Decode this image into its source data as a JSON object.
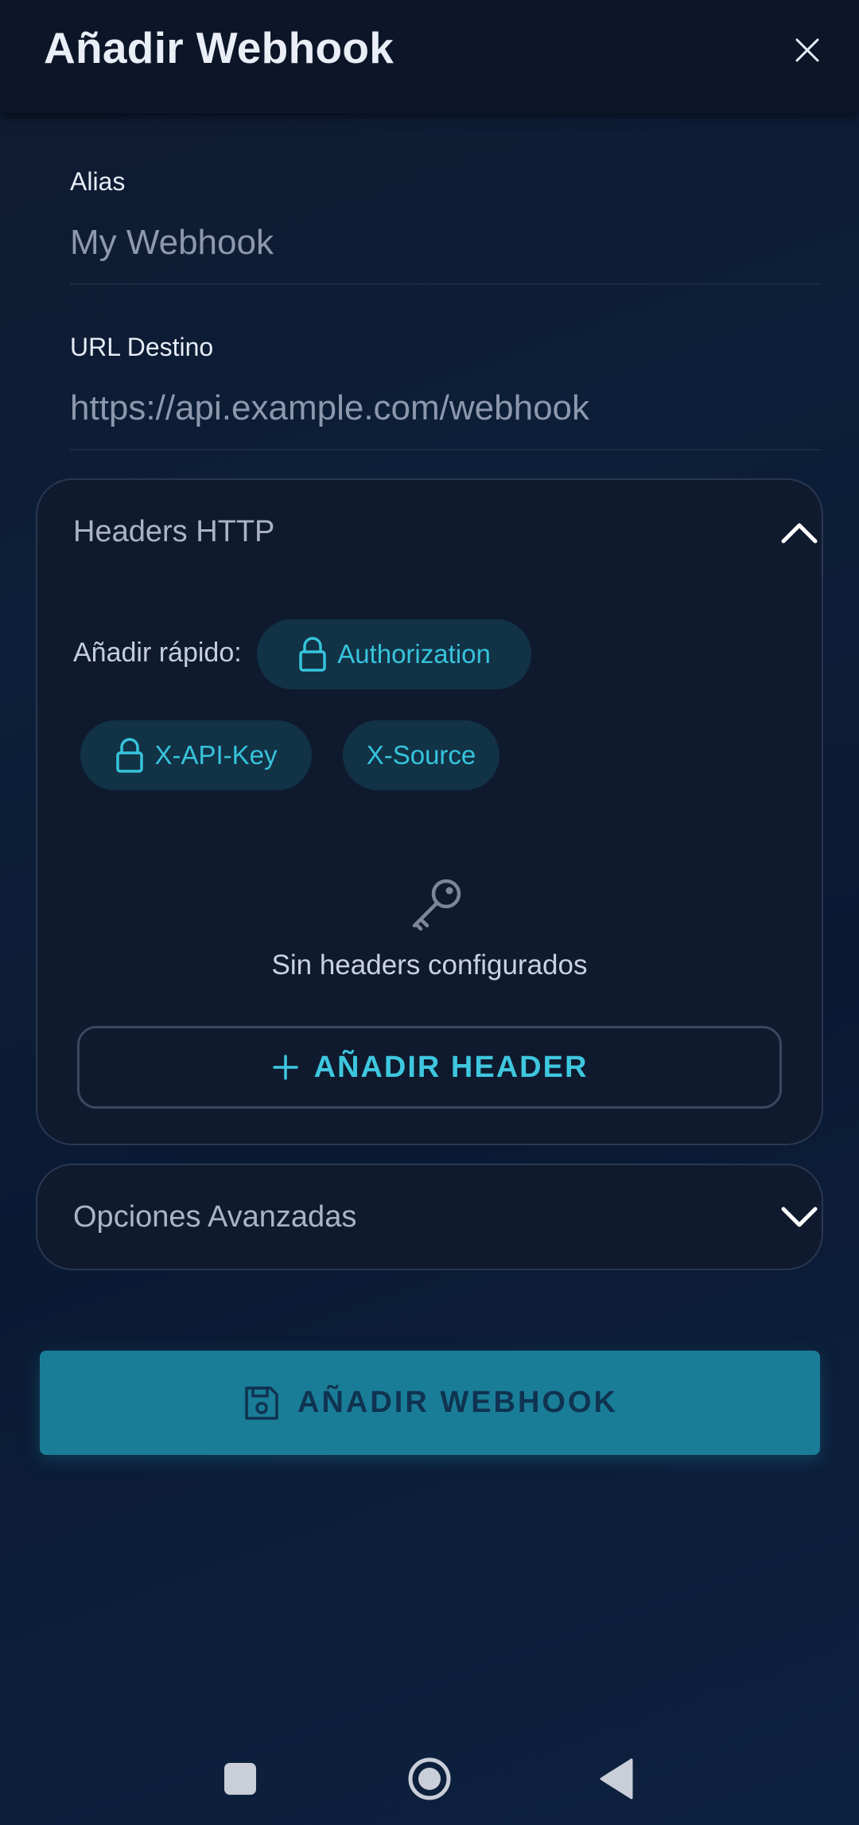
{
  "appbar": {
    "title": "Añadir Webhook",
    "close_icon": "close-icon"
  },
  "form": {
    "alias": {
      "label": "Alias",
      "placeholder": "My Webhook",
      "value": ""
    },
    "url": {
      "label": "URL Destino",
      "placeholder": "https://api.example.com/webhook",
      "value": ""
    }
  },
  "headers_section": {
    "title": "Headers HTTP",
    "expanded": true,
    "quick_add_label": "Añadir rápido:",
    "quick_chips": [
      {
        "label": "Authorization",
        "icon": "lock-icon"
      },
      {
        "label": "X-API-Key",
        "icon": "lock-icon"
      },
      {
        "label": "X-Source",
        "icon": ""
      }
    ],
    "empty_icon": "key-icon",
    "empty_text": "Sin headers configurados",
    "add_button_label": "AÑADIR HEADER"
  },
  "advanced_section": {
    "title": "Opciones Avanzadas",
    "expanded": false
  },
  "submit": {
    "label": "AÑADIR WEBHOOK",
    "icon": "save-icon"
  },
  "navbar": {
    "items": [
      "recents-button",
      "home-button",
      "back-button"
    ]
  },
  "colors": {
    "accent": "#36c4dc",
    "submit_bg": "#1a7d98",
    "chip_bg": "#123246",
    "background": "#0e1a30"
  }
}
